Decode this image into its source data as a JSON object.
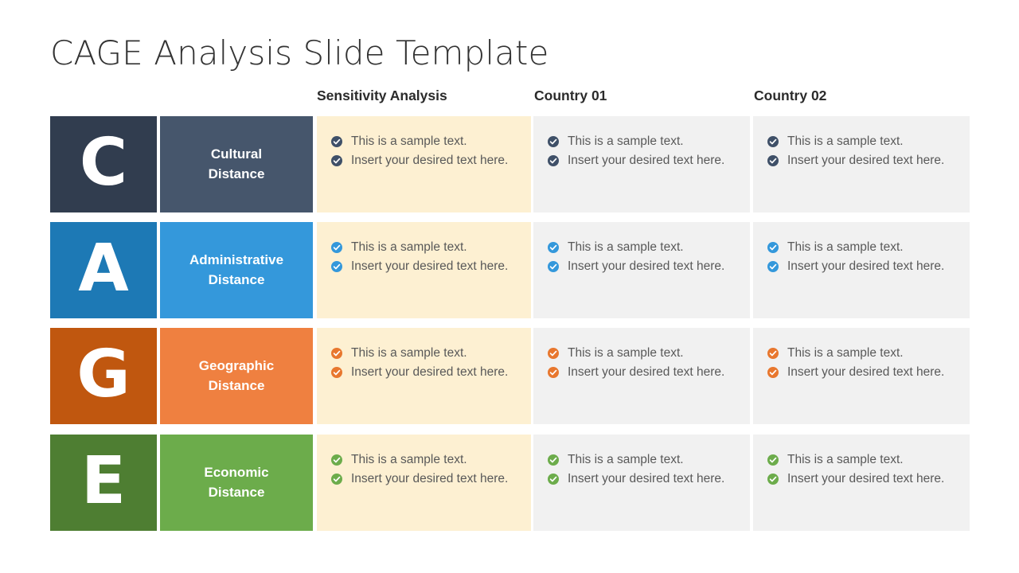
{
  "slide": {
    "title": "CAGE Analysis Slide Template",
    "background_color": "#ffffff"
  },
  "headers": {
    "letter_column": "",
    "label_column": "",
    "sensitivity": "Sensitivity Analysis",
    "country_01": "Country 01",
    "country_02": "Country 02"
  },
  "columns": {
    "sensitivity_bg": "#fdf0d2",
    "country_bg": "#f1f1f1"
  },
  "rows": [
    {
      "letter": "C",
      "label_line1": "Cultural",
      "label_line2": "Distance",
      "letter_bg": "#313d4f",
      "label_bg": "#46566c",
      "accent": "#3f5068",
      "cells": {
        "sensitivity": [
          "This is a sample text.",
          "Insert your desired text here."
        ],
        "country_01": [
          "This is a sample text.",
          "Insert your desired text here."
        ],
        "country_02": [
          "This is a sample text.",
          "Insert your desired text here."
        ]
      }
    },
    {
      "letter": "A",
      "label_line1": "Administrative",
      "label_line2": "Distance",
      "letter_bg": "#1d79b5",
      "label_bg": "#3498db",
      "accent": "#3498db",
      "cells": {
        "sensitivity": [
          "This is a sample text.",
          "Insert your desired text here."
        ],
        "country_01": [
          "This is a sample text.",
          "Insert your desired text here."
        ],
        "country_02": [
          "This is a sample text.",
          "Insert your desired text here."
        ]
      }
    },
    {
      "letter": "G",
      "label_line1": "Geographic",
      "label_line2": "Distance",
      "letter_bg": "#c0570f",
      "label_bg": "#ef8040",
      "accent": "#e8772e",
      "cells": {
        "sensitivity": [
          "This is a sample text.",
          "Insert your desired text here."
        ],
        "country_01": [
          "This is a sample text.",
          "Insert your desired text here."
        ],
        "country_02": [
          "This is a sample text.",
          "Insert your desired text here."
        ]
      }
    },
    {
      "letter": "E",
      "label_line1": "Economic",
      "label_line2": "Distance",
      "letter_bg": "#4e7e32",
      "label_bg": "#6cac4b",
      "accent": "#6cac4b",
      "cells": {
        "sensitivity": [
          "This is a sample text.",
          "Insert your desired text here."
        ],
        "country_01": [
          "This is a sample text.",
          "Insert your desired text here."
        ],
        "country_02": [
          "This is a sample text.",
          "Insert your desired text here."
        ]
      }
    }
  ],
  "icons": {
    "bullet": "check-circle-icon"
  }
}
